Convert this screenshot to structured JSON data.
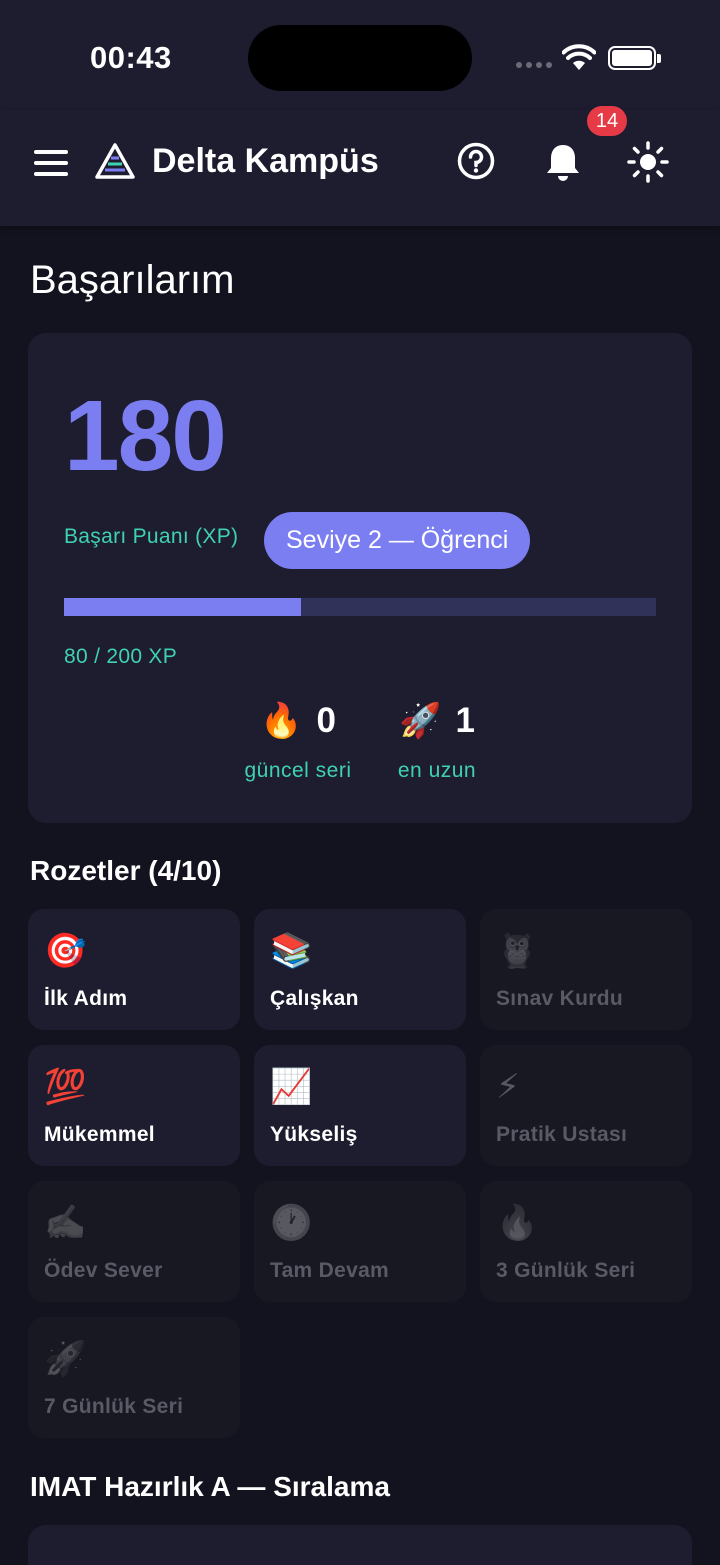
{
  "status_bar": {
    "time": "00:43"
  },
  "app_bar": {
    "title": "Delta Kampüs",
    "notification_count": "14"
  },
  "page_title": "Başarılarım",
  "xp_card": {
    "xp": "180",
    "xp_label": "Başarı Puanı (XP)",
    "level": "Seviye 2 — Öğrenci",
    "progress_text": "80 / 200 XP",
    "progress_fraction": 0.4,
    "current_streak": {
      "emoji": "🔥",
      "value": "0",
      "label": "güncel seri"
    },
    "longest_streak": {
      "emoji": "🚀",
      "value": "1",
      "label": "en uzun"
    }
  },
  "badges_section": {
    "title": "Rozetler (4/10)",
    "items": [
      {
        "icon": "🎯",
        "label": "İlk Adım",
        "earned": true
      },
      {
        "icon": "📚",
        "label": "Çalışkan",
        "earned": true
      },
      {
        "icon": "🦉",
        "label": "Sınav Kurdu",
        "earned": false
      },
      {
        "icon": "💯",
        "label": "Mükemmel",
        "earned": true
      },
      {
        "icon": "📈",
        "label": "Yükseliş",
        "earned": true
      },
      {
        "icon": "⚡",
        "label": "Pratik Ustası",
        "earned": false
      },
      {
        "icon": "✍️",
        "label": "Ödev Sever",
        "earned": false
      },
      {
        "icon": "🕐",
        "label": "Tam Devam",
        "earned": false
      },
      {
        "icon": "🔥",
        "label": "3 Günlük Seri",
        "earned": false
      },
      {
        "icon": "🚀",
        "label": "7 Günlük Seri",
        "earned": false
      }
    ]
  },
  "ranking_section": {
    "title": "IMAT Hazırlık A — Sıralama"
  },
  "colors": {
    "accent": "#7b7ef0",
    "teal": "#3fd1b3",
    "card": "#1e1d30",
    "background": "#13131f",
    "badge_red": "#e63b46"
  }
}
